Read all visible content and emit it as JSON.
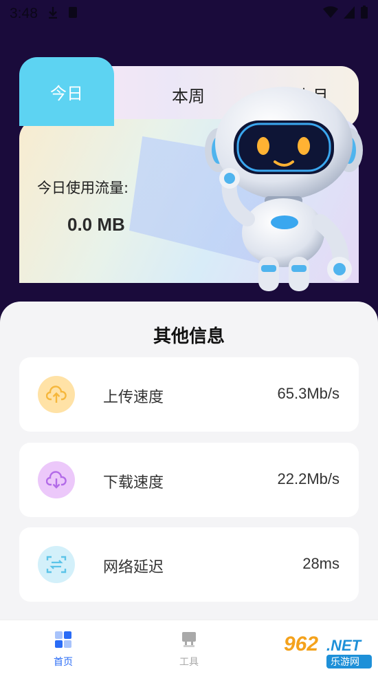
{
  "status_bar": {
    "time": "3:48"
  },
  "tabs": {
    "today": "今日",
    "week": "本周",
    "month": "本月"
  },
  "usage": {
    "label": "今日使用流量:",
    "value": "0.0 MB"
  },
  "other_info": {
    "title": "其他信息",
    "items": [
      {
        "label": "上传速度",
        "value": "65.3Mb/s",
        "icon": "cloud-upload-icon",
        "color": "#fbc964"
      },
      {
        "label": "下载速度",
        "value": "22.2Mb/s",
        "icon": "cloud-download-icon",
        "color": "#c38df0"
      },
      {
        "label": "网络延迟",
        "value": "28ms",
        "icon": "scan-latency-icon",
        "color": "#7fd5ee"
      }
    ]
  },
  "bottom_nav": {
    "home": "首页",
    "tools": "工具"
  },
  "watermark": {
    "brand": "962",
    "suffix": ".NET",
    "site": "乐游网"
  },
  "colors": {
    "background": "#1a0b3b",
    "active_tab": "#5dd3f2",
    "active_nav": "#2a6cf6",
    "inactive_nav": "#a9a9a9"
  }
}
